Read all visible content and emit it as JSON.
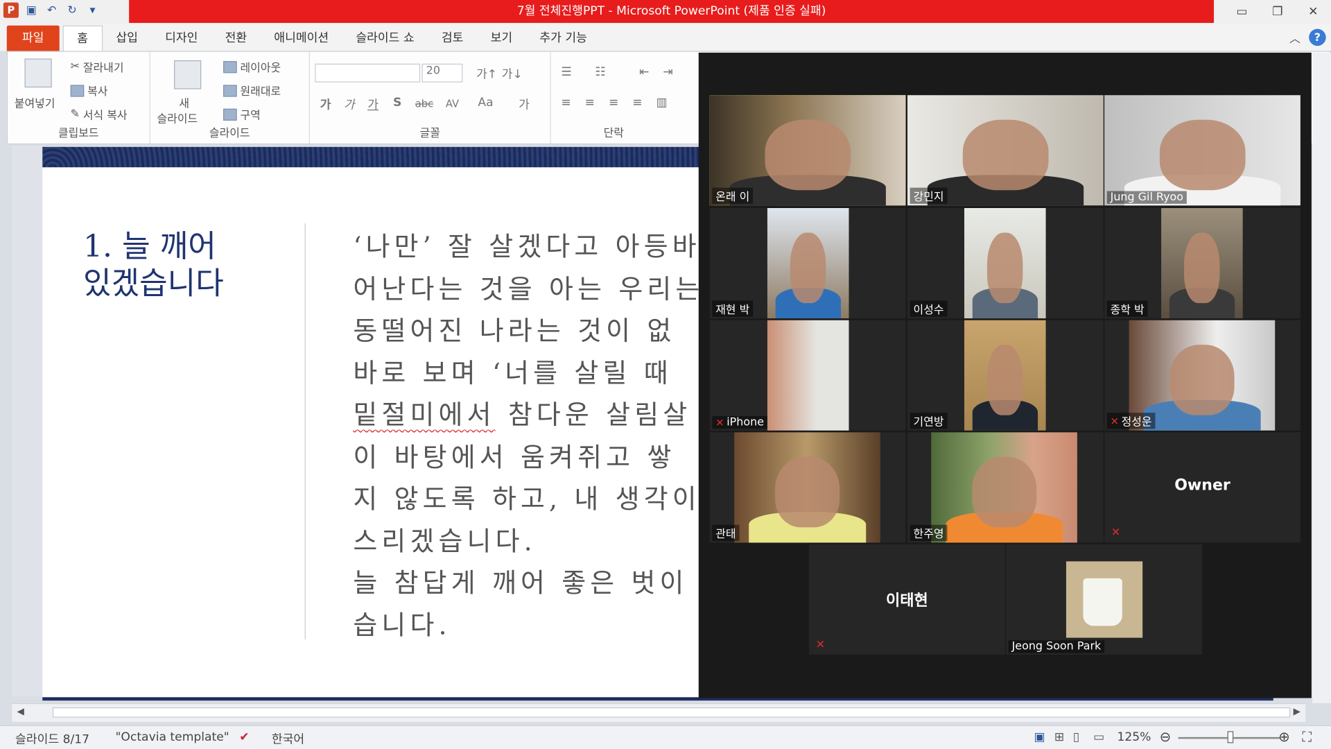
{
  "window": {
    "title": "7월 전체진행PPT - Microsoft PowerPoint (제품 인증 실패)"
  },
  "tabs": [
    "파일",
    "홈",
    "삽입",
    "디자인",
    "전환",
    "애니메이션",
    "슬라이드 쇼",
    "검토",
    "보기",
    "추가 기능"
  ],
  "ribbon": {
    "clipboard": {
      "paste": "붙여넣기",
      "cut": "잘라내기",
      "copy": "복사",
      "format_painter": "서식 복사",
      "label": "클립보드"
    },
    "slides": {
      "new_slide_1": "새",
      "new_slide_2": "슬라이드",
      "layout": "레이아웃",
      "reset": "원래대로",
      "section": "구역",
      "label": "슬라이드"
    },
    "font": {
      "size": "20",
      "bold": "가",
      "italic": "가",
      "underline": "가",
      "shadow": "S",
      "strike": "abc",
      "spacing": "AV",
      "case": "Aa",
      "color": "가",
      "label": "글꼴"
    },
    "paragraph": {
      "label": "단락"
    }
  },
  "slide": {
    "heading_1": "1. 늘 깨어",
    "heading_2": "있겠습니다",
    "lines": [
      "‘나만’ 잘 살겠다고 아등바",
      "어난다는 것을 아는 우리는",
      "동떨어진 나라는 것이 없",
      "바로 보며 ‘너를 살릴 때",
      "{squiggle}이 참다운 살림",
      "이 바탕에서 움켜쥐고 쌓",
      "지 않도록 하고, 내 생각이",
      "스리겠습니다.",
      "늘 참답게 깨어 좋은 벗이",
      "습니다."
    ],
    "squiggle_word": "밑절미에서",
    "line5_rest": " 참다운 살림살"
  },
  "status": {
    "slide_num": "슬라이드 8/17",
    "theme": "\"Octavia template\"",
    "lang": "한국어",
    "zoom": "125%"
  },
  "gallery": {
    "participants": [
      {
        "name": "온래 이",
        "muted": false
      },
      {
        "name": "강민지",
        "muted": false
      },
      {
        "name": "Jung Gil Ryoo",
        "muted": false
      },
      {
        "name": "재현 박",
        "muted": false
      },
      {
        "name": "이성수",
        "muted": false
      },
      {
        "name": "종학 박",
        "muted": false
      },
      {
        "name": "iPhone",
        "muted": true
      },
      {
        "name": "기연방",
        "muted": false
      },
      {
        "name": "정성운",
        "muted": true
      },
      {
        "name": "관태",
        "muted": false
      },
      {
        "name": "한주영",
        "muted": false
      },
      {
        "name": "Owner",
        "muted": true
      },
      {
        "name": "이태현",
        "muted": true
      },
      {
        "name": "Jeong Soon Park",
        "muted": false
      }
    ]
  },
  "colors": {
    "title_bar": "#e81c1c",
    "file_tab": "#e0441c",
    "slide_text": "#1f3470",
    "active_speaker": "#cbe14b",
    "zoom_bg": "#1a1a1a"
  }
}
